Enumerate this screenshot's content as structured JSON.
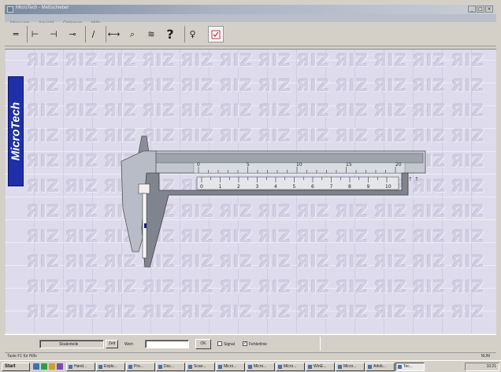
{
  "window": {
    "title": "MicroTech - Meßschieber",
    "controls": {
      "minimize": "_",
      "maximize": "□",
      "close": "×"
    }
  },
  "menu": [
    "Messung",
    "Ansicht",
    "Optionen",
    "Hilfe"
  ],
  "toolbar": {
    "buttons": [
      {
        "icon": "double-line-icon",
        "glyph": "═"
      },
      {
        "icon": "caliper-outside-icon",
        "glyph": "⊢"
      },
      {
        "icon": "caliper-inside-icon",
        "glyph": "⊣"
      },
      {
        "icon": "caliper-depth-icon",
        "glyph": "⊸"
      },
      {
        "icon": "pencil-icon",
        "glyph": "∕"
      },
      {
        "icon": "measure-line-icon",
        "glyph": "⟷"
      },
      {
        "icon": "zoom-measure-icon",
        "glyph": "⌕"
      },
      {
        "icon": "mark-icon",
        "glyph": "≋"
      },
      {
        "icon": "help-icon",
        "glyph": "?"
      },
      {
        "icon": "hint-bulb-icon",
        "glyph": "♀"
      },
      {
        "icon": "check-icon",
        "glyph": "✓"
      }
    ]
  },
  "logo": {
    "text": "MicroTech"
  },
  "watermark": {
    "text": "ЯIZ"
  },
  "caliper": {
    "main_scale_labels": [
      "0",
      "5",
      "10",
      "15",
      "20"
    ],
    "vernier_scale_labels": [
      "0",
      "1",
      "2",
      "3",
      "4",
      "5",
      "6",
      "7",
      "8",
      "9",
      "10"
    ],
    "vernier_position_mm": 0
  },
  "controls": {
    "mode_field": "Skalenteile",
    "mode_button": "Zeit",
    "value_label": "Wert:",
    "value_input": "",
    "ok_button": "OK",
    "signal_label": "Signal",
    "signal_checked": false,
    "fehlerlinie_label": "Fehlerlinie",
    "fehlerlinie_checked": true
  },
  "status": {
    "left": "Taste F1 für Hilfe",
    "right": "NUM"
  },
  "taskbar": {
    "start_label": "Start",
    "tasks": [
      "Hand...",
      "Explo...",
      "Pro...",
      "Doc...",
      "Scan...",
      "Micro...",
      "Micro...",
      "Micro...",
      "WinE...",
      "Micro...",
      "Adob...",
      "Tec..."
    ],
    "clock": "10:21"
  },
  "colors": {
    "canvas": "#dedcec",
    "caliper_body": "#a2a6b0",
    "scale_band": "#c2c7d0",
    "logo_bg": "#1f2fa8"
  }
}
